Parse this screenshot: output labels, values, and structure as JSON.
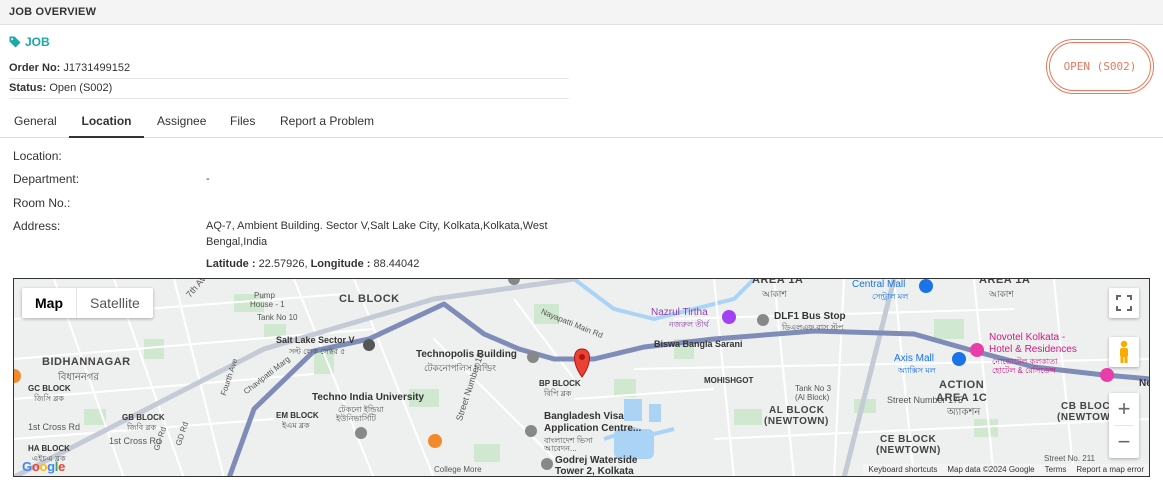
{
  "header": {
    "title": "JOB OVERVIEW"
  },
  "job": {
    "tag_label": "JOB",
    "order_label": "Order No:",
    "order_value": "J1731499152",
    "status_label": "Status:",
    "status_value": "Open (S002)",
    "stamp_text": "OPEN (S002)"
  },
  "tabs": [
    {
      "label": "General"
    },
    {
      "label": "Location"
    },
    {
      "label": "Assignee"
    },
    {
      "label": "Files"
    },
    {
      "label": "Report a Problem"
    }
  ],
  "location": {
    "location_label": "Location:",
    "department_label": "Department:",
    "department_value": "-",
    "room_label": "Room No.:",
    "address_label": "Address:",
    "address_line1": "AQ-7, Ambient Building. Sector V,Salt Lake City, Kolkata,Kolkata,West",
    "address_line2": "Bengal,India",
    "latitude_label": "Latitude :",
    "latitude_value": "22.57926",
    "longitude_label": "Longitude :",
    "longitude_value": "88.44042"
  },
  "map": {
    "type_map": "Map",
    "type_satellite": "Satellite",
    "zoom_in": "+",
    "zoom_out": "−",
    "google": "Google",
    "attribution": [
      "Keyboard shortcuts",
      "Map data ©2024 Google",
      "Terms",
      "Report a map error"
    ],
    "labels": {
      "area1a": "AREA 1A",
      "area1a_bn": "আকাশ",
      "area1a_r": "AREA 1A",
      "area1a_r_bn": "আকাশ",
      "cl_block": "CL BLOCK",
      "bidhannagar": "BIDHANNAGAR",
      "bidhannagar_bn": "বিধাননগর",
      "salt_lake": "Salt Lake Sector V",
      "salt_lake_bn": "সল্ট লেক সেক্টর ৫",
      "technopolis": "Technopolis Building",
      "technopolis_bn": "টেকনোপলিস বিল্ডিং",
      "techno_india": "Techno India University",
      "techno_india_bn": "টেকনো ইন্ডিয়া",
      "techno_india_bn2": "ইউনিভার্সিটি",
      "pump_house": "Pump",
      "pump_house2": "House - 1",
      "tank10": "Tank No 10",
      "nazrul": "Nazrul Tirtha",
      "nazrul_bn": "নজরুল তীর্থ",
      "dlf": "DLF1 Bus Stop",
      "dlf_bn": "ডিএলএফ বাস স্টপ",
      "central_mall": "Central Mall",
      "central_mall_bn": "সেন্ট্রাল মল",
      "novotel": "Novotel Kolkata -",
      "novotel2": "Hotel & Residences",
      "novotel_bn": "নোভোটেল কলকাতা",
      "novotel_bn2": "হোটেল & রেসিডেন্স",
      "axis_mall": "Axis Mall",
      "axis_mall_bn": "অ্যাক্সিস মল",
      "action_area": "ACTION",
      "action_area2": "AREA 1C",
      "action_area_bn": "অ্যাকশন",
      "biswa": "Biswa Bangla Sarani",
      "nayapatti": "Nayapatti Main Rd",
      "bp_block": "BP BLOCK",
      "bp_block_bn": "বিপি ব্লক",
      "bangladesh_visa": "Bangladesh Visa",
      "bangladesh_visa2": "Application Centre...",
      "bangladesh_visa_bn": "বাংলাদেশ ভিসা",
      "bangladesh_visa_bn2": "আবেদন...",
      "godrej": "Godrej Waterside",
      "godrej2": "Tower 2, Kolkata",
      "college_more": "College More",
      "mohishgot": "MOHISHGOT",
      "tank3": "Tank No 3",
      "tank3b": "(Al Block)",
      "al_block": "AL BLOCK",
      "al_block2": "(NEWTOWN)",
      "ce_block": "CE BLOCK",
      "ce_block2": "(NEWTOWN)",
      "cb_block": "CB BLOCK",
      "cb_block2": "(NEWTOW",
      "street175": "Street Number 175",
      "street18": "Street Number 18",
      "street211": "Street No. 211",
      "chavlpatti": "Chavlpatti Marg",
      "fourth_ave": "Fourth Ave",
      "gc_block": "GC BLOCK",
      "gc_block_bn": "জিসি ব্লক",
      "gb_block": "GB BLOCK",
      "gb_block_bn": "জিবি ব্লক",
      "ha_block": "HA BLOCK",
      "ha_block_bn": "এইচএ ব্লক",
      "em_block": "EM BLOCK",
      "em_block_bn": "ইএম ব্লক",
      "first_cross": "1st Cross Rd",
      "first_cross2": "1st Cross Rd",
      "gd_rd": "GD Rd",
      "gc_rd": "GC Rd",
      "seventh_ave": "7th Av",
      "ne": "Ne"
    }
  }
}
